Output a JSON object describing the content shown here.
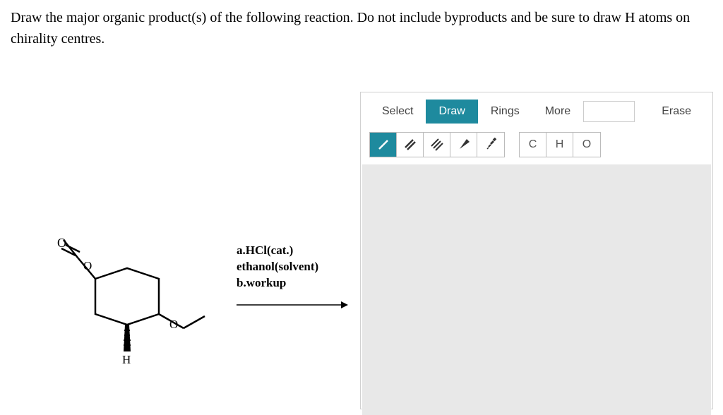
{
  "question": "Draw the major organic product(s) of the following reaction. Do not include byproducts and be sure to draw H atoms on chirality centres.",
  "reaction": {
    "condition_a_prefix": "a.",
    "condition_a_reagent": "HCl",
    "condition_a_note": "(cat.)",
    "condition_solvent_name": "ethanol",
    "condition_solvent_note": "(solvent)",
    "condition_b": "b.workup"
  },
  "toolbar": {
    "select": "Select",
    "draw": "Draw",
    "rings": "Rings",
    "more": "More",
    "erase": "Erase"
  },
  "atoms": {
    "c": "C",
    "h": "H",
    "o": "O"
  }
}
